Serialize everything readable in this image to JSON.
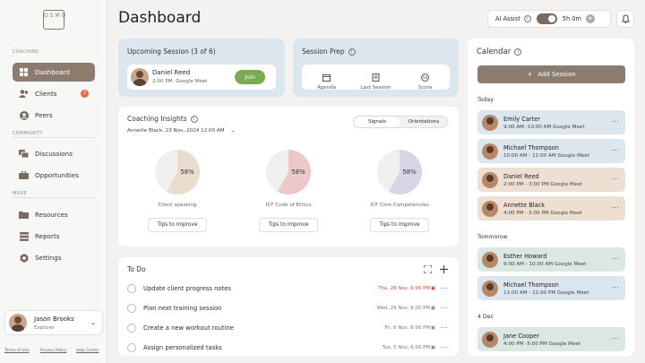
{
  "app": {
    "title": "Dashboard",
    "logo_text": "OSMO"
  },
  "colors": {
    "accent": "#8c7b6f",
    "join": "#7aab54",
    "blue": "#dce6ee",
    "green": "#dbe7e3",
    "beige": "#ede0d2",
    "badge": "#e2674a"
  },
  "sidebar": {
    "coaching_label": "COACHING",
    "community_label": "COMMUNITY",
    "more_label": "MORE",
    "items": [
      {
        "label": "Dashboard",
        "icon": "grid-icon"
      },
      {
        "label": "Clients",
        "icon": "users-icon",
        "badge": "2"
      },
      {
        "label": "Peers",
        "icon": "person-circle-icon"
      },
      {
        "label": "Discussions",
        "icon": "chat-icon"
      },
      {
        "label": "Opportunities",
        "icon": "briefcase-icon"
      },
      {
        "label": "Resources",
        "icon": "folder-icon"
      },
      {
        "label": "Reports",
        "icon": "list-icon"
      },
      {
        "label": "Settings",
        "icon": "gear-icon"
      }
    ],
    "user": {
      "name": "Jason Brooks",
      "role": "Explorer"
    },
    "footer": {
      "terms": "Terms of Use",
      "privacy": "Privacy Policy",
      "help": "Help Center"
    }
  },
  "topbar": {
    "ai_assist": "AI Assist",
    "timer": "5h 0m"
  },
  "upcoming": {
    "title": "Upcoming Session (3 of 6)",
    "name": "Daniel Reed",
    "detail": "2:00 PM, Google Meet",
    "join": "Join"
  },
  "prep": {
    "title": "Session Prep",
    "items": [
      {
        "label": "Agenda",
        "icon": "calendar-icon"
      },
      {
        "label": "Last Session",
        "icon": "document-icon"
      },
      {
        "label": "Score",
        "icon": "score-icon"
      }
    ]
  },
  "insights": {
    "title": "Coaching Insights",
    "subtitle": "Annette Black, 23 Nov, 2024 12:00 AM",
    "tabs": [
      "Signals",
      "Orientations"
    ],
    "pies": [
      {
        "label": "Client speaking",
        "value": 58,
        "pct": "58%",
        "color": "#e8dccd"
      },
      {
        "label": "ICF Code of Ethics",
        "value": 58,
        "pct": "58%",
        "color": "#ecc8c8"
      },
      {
        "label": "ICF Core Competencies",
        "value": 58,
        "pct": "58%",
        "color": "#d9d5e6"
      }
    ],
    "tips": "Tips to improve"
  },
  "todo": {
    "title": "To Do",
    "items": [
      {
        "text": "Update client progress notes",
        "date": "Thu, 28 Nov, 6:00 PM",
        "overdue": true
      },
      {
        "text": "Plan next training session",
        "date": "Wed, 29 Nov, 6:00 PM",
        "overdue": false
      },
      {
        "text": "Create a new workout routine",
        "date": "Fri, 6 Nov, 6:00 PM",
        "overdue": false
      },
      {
        "text": "Assign personalized tasks",
        "date": "Tue, 5 Nov, 6:00 PM",
        "overdue": false
      }
    ]
  },
  "calendar": {
    "title": "Calendar",
    "add": "Add Session",
    "groups": [
      {
        "day": "Today",
        "items": [
          {
            "name": "Emily Carter",
            "time": "9:00 AM -10:00 AM Google Meet",
            "color": "#dce6ee"
          },
          {
            "name": "Michael Thompson",
            "time": "10:00 AM - 11:00 AM Google Meet",
            "color": "#dce6ee"
          },
          {
            "name": "Daniel Reed",
            "time": "2:00 PM - 3:00 PM Google Meet",
            "color": "#ede0d2"
          },
          {
            "name": "Annette Black",
            "time": "4:00 PM - 5:00 PM Google Meet",
            "color": "#ede0d2"
          }
        ]
      },
      {
        "day": "Tommorow",
        "items": [
          {
            "name": "Esther Howard",
            "time": "9:00 AM - 10:00 AM Google Meet",
            "color": "#dbe7e3"
          },
          {
            "name": "Michael Thompson",
            "time": "11:00 AM - 12:00 PM Google Meet",
            "color": "#dce6ee"
          }
        ]
      },
      {
        "day": "4 Dec",
        "items": [
          {
            "name": "Jane Cooper",
            "time": "4:00 PM -5:00 PM Google Meet",
            "color": "#dbe7e3"
          }
        ]
      }
    ]
  }
}
